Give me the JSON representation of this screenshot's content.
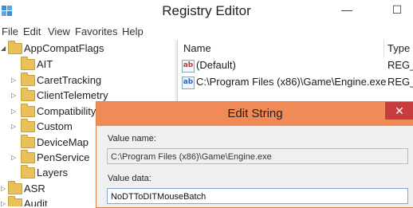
{
  "window": {
    "title": "Registry Editor",
    "minimize_glyph": "—",
    "maximize_glyph": "☐"
  },
  "menu": [
    "File",
    "Edit",
    "View",
    "Favorites",
    "Help"
  ],
  "tree": {
    "nodes": [
      {
        "label": "AppCompatFlags",
        "expanded": true
      },
      {
        "label": "AIT",
        "expanded": false
      },
      {
        "label": "CaretTracking",
        "expanded": false
      },
      {
        "label": "ClientTelemetry",
        "expanded": false
      },
      {
        "label": "Compatibility",
        "expanded": false
      },
      {
        "label": "Custom",
        "expanded": false
      },
      {
        "label": "DeviceMap",
        "expanded": false
      },
      {
        "label": "PenService",
        "expanded": false
      },
      {
        "label": "Layers",
        "expanded": false
      },
      {
        "label": "ASR",
        "expanded": false
      },
      {
        "label": "Audit",
        "expanded": false
      }
    ]
  },
  "list": {
    "columns": [
      "Name",
      "Type"
    ],
    "rows": [
      {
        "icon": "string-value-icon",
        "name": "(Default)",
        "type": "REG_"
      },
      {
        "icon": "string-value-icon",
        "name": "C:\\Program Files (x86)\\Game\\Engine.exe",
        "type": "REG_"
      }
    ]
  },
  "dialog": {
    "title": "Edit String",
    "close_glyph": "✕",
    "value_name_label": "Value name:",
    "value_name": "C:\\Program Files (x86)\\Game\\Engine.exe",
    "value_data_label": "Value data:",
    "value_data": "NoDTToDITMouseBatch"
  },
  "colors": {
    "dialog_title_bar": "#f08a56",
    "close_button": "#c73c3c",
    "folder": "#e8c15a"
  }
}
